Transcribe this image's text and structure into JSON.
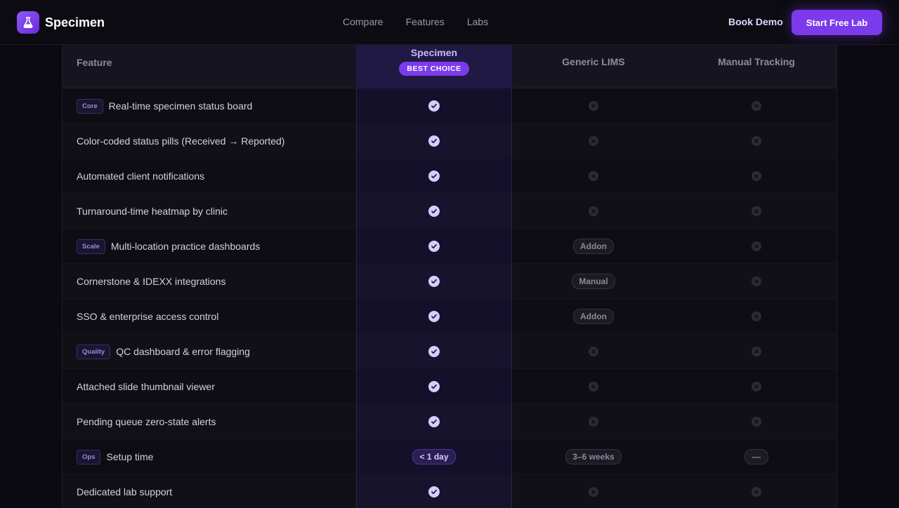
{
  "nav": {
    "brand": "Specimen",
    "links": [
      "Compare",
      "Features",
      "Labs"
    ],
    "book_demo": "Book Demo",
    "cta": "Start Free Lab"
  },
  "table": {
    "header": {
      "feature": "Feature",
      "specimen": "Specimen",
      "badge": "BEST CHOICE",
      "generic": "Generic LIMS",
      "manual": "Manual Tracking"
    },
    "rows": [
      {
        "tag": "Core",
        "feature": "Real-time specimen status board",
        "specimen": "check",
        "generic": "cross",
        "manual": "cross"
      },
      {
        "tag": "",
        "feature": "Color-coded status pills (Received → Reported)",
        "specimen": "check",
        "generic": "cross",
        "manual": "cross"
      },
      {
        "tag": "",
        "feature": "Automated client notifications",
        "specimen": "check",
        "generic": "cross",
        "manual": "cross"
      },
      {
        "tag": "",
        "feature": "Turnaround-time heatmap by clinic",
        "specimen": "check",
        "generic": "cross",
        "manual": "cross"
      },
      {
        "tag": "Scale",
        "feature": "Multi-location practice dashboards",
        "specimen": "check",
        "generic": "Addon",
        "manual": "cross"
      },
      {
        "tag": "",
        "feature": "Cornerstone & IDEXX integrations",
        "specimen": "check",
        "generic": "Manual",
        "manual": "cross"
      },
      {
        "tag": "",
        "feature": "SSO & enterprise access control",
        "specimen": "check",
        "generic": "Addon",
        "manual": "cross"
      },
      {
        "tag": "Quality",
        "feature": "QC dashboard & error flagging",
        "specimen": "check",
        "generic": "cross",
        "manual": "cross"
      },
      {
        "tag": "",
        "feature": "Attached slide thumbnail viewer",
        "specimen": "check",
        "generic": "cross",
        "manual": "cross"
      },
      {
        "tag": "",
        "feature": "Pending queue zero-state alerts",
        "specimen": "check",
        "generic": "cross",
        "manual": "cross"
      },
      {
        "tag": "Ops",
        "feature": "Setup time",
        "specimen": "< 1 day",
        "generic": "3–6 weeks",
        "manual": "—"
      },
      {
        "tag": "",
        "feature": "Dedicated lab support",
        "specimen": "check",
        "generic": "cross",
        "manual": "cross"
      }
    ]
  },
  "colors": {
    "accent": "#7c3aed",
    "check": "#d9ccff",
    "background": "#0b0a10"
  },
  "icons": {
    "logo": "flask-icon",
    "included": "check-icon",
    "excluded": "x-icon"
  }
}
